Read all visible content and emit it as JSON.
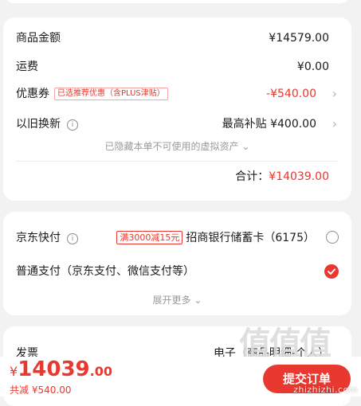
{
  "summary": {
    "goods_label": "商品金额",
    "goods_value": "¥14579.00",
    "shipping_label": "运费",
    "shipping_value": "¥0.00",
    "coupon_label": "优惠券",
    "coupon_badge": "已选推荐优惠（含PLUS津贴）",
    "coupon_value": "-¥540.00",
    "tradein_label": "以旧换新",
    "tradein_value": "最高补贴 ¥400.00",
    "hidden_assets": "已隐藏本单不可使用的虚拟资产",
    "total_label": "合计：",
    "total_value": "¥14039.00"
  },
  "payment": {
    "jd_quickpay_label": "京东快付",
    "jd_quickpay_promo": "满3000减15元",
    "jd_quickpay_card": "招商银行储蓄卡（6175）",
    "normal_label": "普通支付（京东支付、微信支付等）",
    "expand": "展开更多"
  },
  "invoice": {
    "label": "发票",
    "value": "电子（商品明细-个人）"
  },
  "bottom": {
    "currency": "¥",
    "total_int": "14039",
    "total_dec": ".00",
    "saved_label": "共减",
    "saved_value": "¥540.00",
    "submit": "提交订单"
  },
  "watermark": {
    "logo": "值值值",
    "url": "zhizhizhi.com"
  },
  "colors": {
    "accent": "#e8382f",
    "background": "#f2f2f2"
  }
}
